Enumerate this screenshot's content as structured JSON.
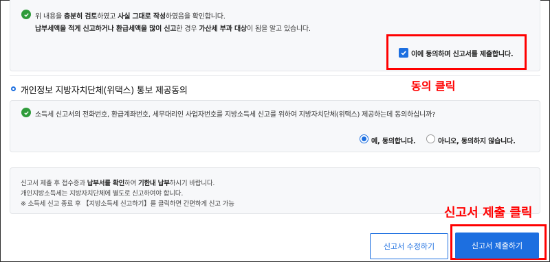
{
  "confirm": {
    "line1": {
      "p1": "위 내용을 ",
      "b1": "충분히 검토",
      "p2": "하였고 ",
      "b2": "사실 그대로 작성",
      "p3": "하였음을 확인합니다."
    },
    "line2": {
      "b1": "납부세액을 적게 신고하거나 환급세액을 많이 신고",
      "p1": "한 경우 ",
      "b2": "가산세 부과 대상",
      "p2": "이 됨을 알고 있습니다."
    },
    "agree_checkbox_label": "이에 동의하며 신고서를 제출합니다.",
    "agree_checked": true
  },
  "privacy_section": {
    "title": "개인정보 지방자치단체(위택스) 통보 제공동의",
    "question": "소득세 신고서의 전화번호, 환급계좌번호, 세무대리인 사업자번호를 지방소득세 신고를 위하여 지방자치단체(위택스) 제공하는데 동의하십니까?",
    "options": [
      {
        "label": "예, 동의합니다.",
        "selected": true
      },
      {
        "label": "아니오, 동의하지 않습니다.",
        "selected": false
      }
    ]
  },
  "notice": {
    "line1": {
      "p1": "신고서 제출 후 접수증과 ",
      "b1": "납부서를 확인",
      "p2": "하여 ",
      "b2": "기한내 납부",
      "p3": "하시기 바랍니다."
    },
    "line2": "개인지방소득세는 지방자치단체에 별도로 신고하여야 합니다.",
    "line3": "※ 소득세 신고 종료 후 【지방소득세 신고하기】를 클릭하면 간편하게 신고 가능"
  },
  "buttons": {
    "edit": "신고서 수정하기",
    "submit": "신고서 제출하기"
  },
  "annotations": {
    "agree_click": "동의 클릭",
    "submit_click": "신고서 제출 클릭"
  },
  "colors": {
    "accent": "#1d6fe0",
    "check_green": "#2e9b3a",
    "annotation_red": "#ff0000"
  }
}
